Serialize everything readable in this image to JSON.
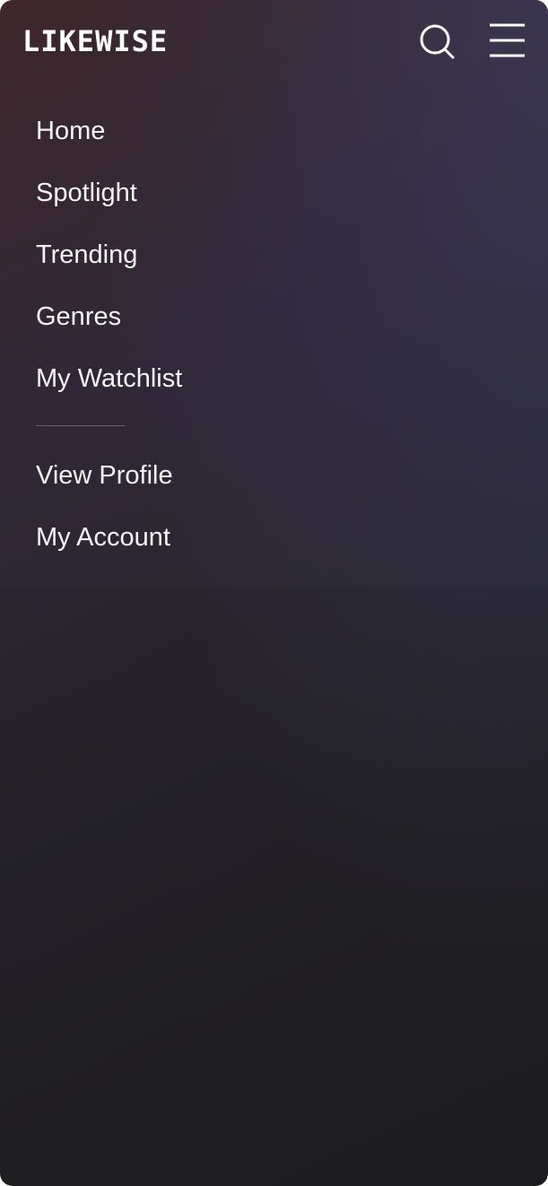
{
  "brand": {
    "logo_text": "LIKEWISE"
  },
  "header": {
    "search_icon": "search-icon",
    "menu_icon": "hamburger-menu-icon"
  },
  "nav": {
    "primary": [
      {
        "label": "Home"
      },
      {
        "label": "Spotlight"
      },
      {
        "label": "Trending"
      },
      {
        "label": "Genres"
      },
      {
        "label": "My Watchlist"
      }
    ],
    "secondary": [
      {
        "label": "View Profile"
      },
      {
        "label": "My Account"
      }
    ]
  },
  "colors": {
    "text": "#f4f4f6",
    "background_top": "#3a2428",
    "background_bottom": "#1c1c1e",
    "accent_glow": "#3c3e64"
  }
}
